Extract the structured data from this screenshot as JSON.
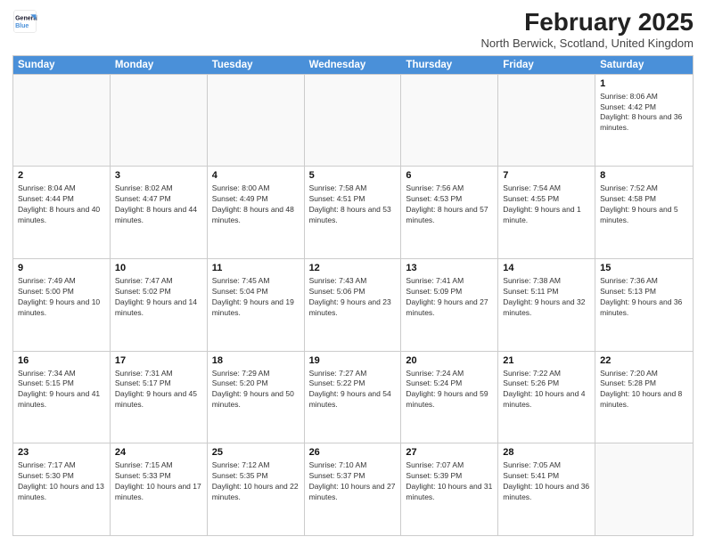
{
  "logo": {
    "line1": "General",
    "line2": "Blue"
  },
  "title": "February 2025",
  "location": "North Berwick, Scotland, United Kingdom",
  "weekdays": [
    "Sunday",
    "Monday",
    "Tuesday",
    "Wednesday",
    "Thursday",
    "Friday",
    "Saturday"
  ],
  "rows": [
    [
      {
        "day": "",
        "text": ""
      },
      {
        "day": "",
        "text": ""
      },
      {
        "day": "",
        "text": ""
      },
      {
        "day": "",
        "text": ""
      },
      {
        "day": "",
        "text": ""
      },
      {
        "day": "",
        "text": ""
      },
      {
        "day": "1",
        "text": "Sunrise: 8:06 AM\nSunset: 4:42 PM\nDaylight: 8 hours and 36 minutes."
      }
    ],
    [
      {
        "day": "2",
        "text": "Sunrise: 8:04 AM\nSunset: 4:44 PM\nDaylight: 8 hours and 40 minutes."
      },
      {
        "day": "3",
        "text": "Sunrise: 8:02 AM\nSunset: 4:47 PM\nDaylight: 8 hours and 44 minutes."
      },
      {
        "day": "4",
        "text": "Sunrise: 8:00 AM\nSunset: 4:49 PM\nDaylight: 8 hours and 48 minutes."
      },
      {
        "day": "5",
        "text": "Sunrise: 7:58 AM\nSunset: 4:51 PM\nDaylight: 8 hours and 53 minutes."
      },
      {
        "day": "6",
        "text": "Sunrise: 7:56 AM\nSunset: 4:53 PM\nDaylight: 8 hours and 57 minutes."
      },
      {
        "day": "7",
        "text": "Sunrise: 7:54 AM\nSunset: 4:55 PM\nDaylight: 9 hours and 1 minute."
      },
      {
        "day": "8",
        "text": "Sunrise: 7:52 AM\nSunset: 4:58 PM\nDaylight: 9 hours and 5 minutes."
      }
    ],
    [
      {
        "day": "9",
        "text": "Sunrise: 7:49 AM\nSunset: 5:00 PM\nDaylight: 9 hours and 10 minutes."
      },
      {
        "day": "10",
        "text": "Sunrise: 7:47 AM\nSunset: 5:02 PM\nDaylight: 9 hours and 14 minutes."
      },
      {
        "day": "11",
        "text": "Sunrise: 7:45 AM\nSunset: 5:04 PM\nDaylight: 9 hours and 19 minutes."
      },
      {
        "day": "12",
        "text": "Sunrise: 7:43 AM\nSunset: 5:06 PM\nDaylight: 9 hours and 23 minutes."
      },
      {
        "day": "13",
        "text": "Sunrise: 7:41 AM\nSunset: 5:09 PM\nDaylight: 9 hours and 27 minutes."
      },
      {
        "day": "14",
        "text": "Sunrise: 7:38 AM\nSunset: 5:11 PM\nDaylight: 9 hours and 32 minutes."
      },
      {
        "day": "15",
        "text": "Sunrise: 7:36 AM\nSunset: 5:13 PM\nDaylight: 9 hours and 36 minutes."
      }
    ],
    [
      {
        "day": "16",
        "text": "Sunrise: 7:34 AM\nSunset: 5:15 PM\nDaylight: 9 hours and 41 minutes."
      },
      {
        "day": "17",
        "text": "Sunrise: 7:31 AM\nSunset: 5:17 PM\nDaylight: 9 hours and 45 minutes."
      },
      {
        "day": "18",
        "text": "Sunrise: 7:29 AM\nSunset: 5:20 PM\nDaylight: 9 hours and 50 minutes."
      },
      {
        "day": "19",
        "text": "Sunrise: 7:27 AM\nSunset: 5:22 PM\nDaylight: 9 hours and 54 minutes."
      },
      {
        "day": "20",
        "text": "Sunrise: 7:24 AM\nSunset: 5:24 PM\nDaylight: 9 hours and 59 minutes."
      },
      {
        "day": "21",
        "text": "Sunrise: 7:22 AM\nSunset: 5:26 PM\nDaylight: 10 hours and 4 minutes."
      },
      {
        "day": "22",
        "text": "Sunrise: 7:20 AM\nSunset: 5:28 PM\nDaylight: 10 hours and 8 minutes."
      }
    ],
    [
      {
        "day": "23",
        "text": "Sunrise: 7:17 AM\nSunset: 5:30 PM\nDaylight: 10 hours and 13 minutes."
      },
      {
        "day": "24",
        "text": "Sunrise: 7:15 AM\nSunset: 5:33 PM\nDaylight: 10 hours and 17 minutes."
      },
      {
        "day": "25",
        "text": "Sunrise: 7:12 AM\nSunset: 5:35 PM\nDaylight: 10 hours and 22 minutes."
      },
      {
        "day": "26",
        "text": "Sunrise: 7:10 AM\nSunset: 5:37 PM\nDaylight: 10 hours and 27 minutes."
      },
      {
        "day": "27",
        "text": "Sunrise: 7:07 AM\nSunset: 5:39 PM\nDaylight: 10 hours and 31 minutes."
      },
      {
        "day": "28",
        "text": "Sunrise: 7:05 AM\nSunset: 5:41 PM\nDaylight: 10 hours and 36 minutes."
      },
      {
        "day": "",
        "text": ""
      }
    ]
  ]
}
